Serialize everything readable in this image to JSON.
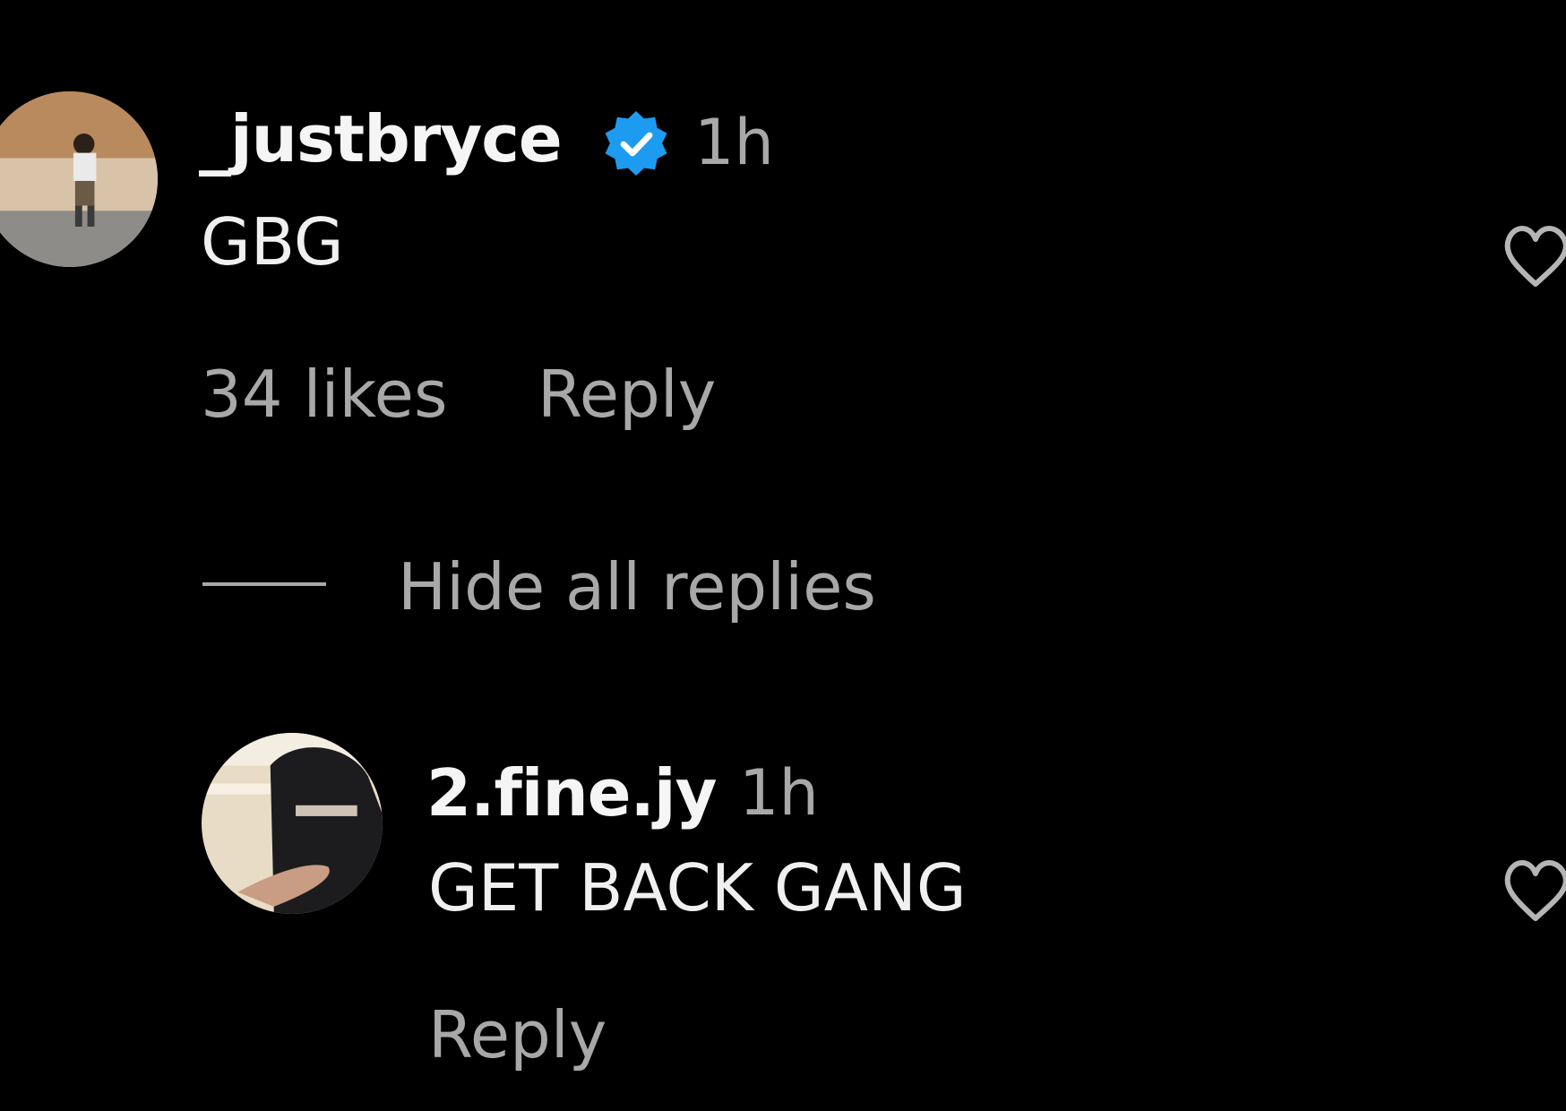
{
  "comments": [
    {
      "username": "_justbryce",
      "verified": true,
      "time": "1h",
      "text": "GBG",
      "likes": "34 likes",
      "reply_label": "Reply",
      "like_icon": "heart-outline-icon"
    }
  ],
  "replies_toggle": {
    "label": "Hide all replies"
  },
  "replies": [
    {
      "username": "2.fine.jy",
      "time": "1h",
      "text": "GET BACK GANG",
      "reply_label": "Reply",
      "like_icon": "heart-outline-icon"
    }
  ],
  "colors": {
    "background": "#000000",
    "verified_badge": "#1d9bf0",
    "secondary_text": "#a8a8a8",
    "primary_text": "#f5f5f5"
  }
}
